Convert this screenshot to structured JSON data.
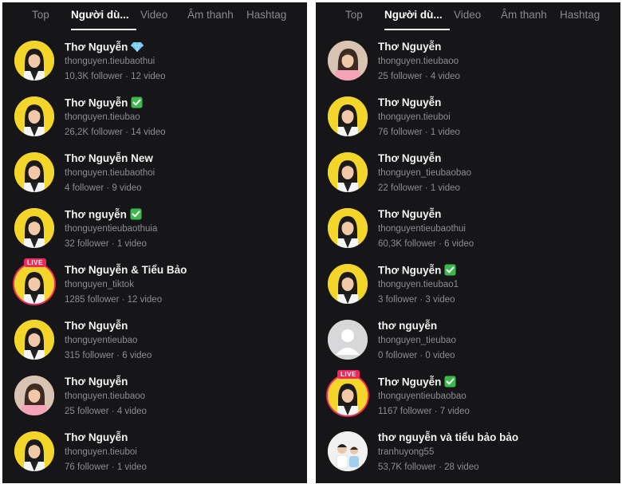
{
  "left_panel": {
    "tabs": [
      "Top",
      "Người dù...",
      "Video",
      "Âm thanh",
      "Hashtag"
    ],
    "active_tab": "Người dù...",
    "users": [
      {
        "name": "Thơ Nguyễn",
        "badge": "diamond-icon",
        "handle": "thonguyen.tieubaothui",
        "stats": "10,3K follower · 12 video",
        "avatar": "yellow-girl",
        "live": false
      },
      {
        "name": "Thơ Nguyễn",
        "badge": "verified-check-icon",
        "handle": "thonguyen.tieubao",
        "stats": "26,2K follower · 14 video",
        "avatar": "yellow-girl",
        "live": false
      },
      {
        "name": "Thơ Nguyễn New",
        "badge": "",
        "handle": "thonguyen.tieubaothoi",
        "stats": "4 follower · 9 video",
        "avatar": "yellow-girl",
        "live": false
      },
      {
        "name": "Thơ nguyễn",
        "badge": "verified-check-icon",
        "handle": "thonguyentieubaothuia",
        "stats": "32 follower · 1 video",
        "avatar": "yellow-girl",
        "live": false
      },
      {
        "name": "Thơ Nguyễn & Tiểu Bảo",
        "badge": "",
        "handle": "thonguyen_tiktok",
        "stats": "1285 follower · 12 video",
        "avatar": "yellow-girl",
        "live": true,
        "live_label": "LIVE"
      },
      {
        "name": "Thơ Nguyễn",
        "badge": "",
        "handle": "thonguyentieubao",
        "stats": "315 follower · 6 video",
        "avatar": "yellow-girl",
        "live": false
      },
      {
        "name": "Thơ Nguyễn",
        "badge": "",
        "handle": "thonguyen.tieubaoo",
        "stats": "25 follower · 4 video",
        "avatar": "pink-girl",
        "live": false
      },
      {
        "name": "Thơ Nguyễn",
        "badge": "",
        "handle": "thonguyen.tieuboi",
        "stats": "76 follower · 1 video",
        "avatar": "yellow-girl",
        "live": false
      }
    ]
  },
  "right_panel": {
    "tabs": [
      "Top",
      "Người dù...",
      "Video",
      "Âm thanh",
      "Hashtag"
    ],
    "active_tab": "Người dù...",
    "users": [
      {
        "name": "Thơ Nguyễn",
        "badge": "",
        "handle": "thonguyen.tieubaoo",
        "stats": "25 follower · 4 video",
        "avatar": "pink-girl",
        "live": false
      },
      {
        "name": "Thơ Nguyễn",
        "badge": "",
        "handle": "thonguyen.tieuboi",
        "stats": "76 follower · 1 video",
        "avatar": "yellow-girl",
        "live": false
      },
      {
        "name": "Thơ Nguyễn",
        "badge": "",
        "handle": "thonguyen_tieubaobao",
        "stats": "22 follower · 1 video",
        "avatar": "yellow-girl",
        "live": false
      },
      {
        "name": "Thơ Nguyễn",
        "badge": "",
        "handle": "thonguyentieubaothui",
        "stats": "60,3K follower · 6 video",
        "avatar": "yellow-girl",
        "live": false
      },
      {
        "name": "Thơ Nguyễn",
        "badge": "verified-check-icon",
        "handle": "thonguyen.tieubao1",
        "stats": "3 follower · 3 video",
        "avatar": "yellow-girl",
        "live": false
      },
      {
        "name": "thơ nguyễn",
        "badge": "",
        "handle": "thonguyen_tieubao",
        "stats": "0 follower · 0 video",
        "avatar": "default-gray",
        "live": false
      },
      {
        "name": "Thơ Nguyễn",
        "badge": "verified-check-icon",
        "handle": "thonguyentieubaobao",
        "stats": "1167 follower · 7 video",
        "avatar": "yellow-girl",
        "live": true,
        "live_label": "LIVE"
      },
      {
        "name": "thơ nguyễn và tiểu bảo bảo",
        "badge": "",
        "handle": "tranhuyong55",
        "stats": "53,7K follower · 28 video",
        "avatar": "white-couple",
        "live": false
      }
    ]
  },
  "colors": {
    "panel_bg": "#161618",
    "text_primary": "#f2f2f2",
    "text_secondary": "#8d8d90",
    "live_red": "#ee2a5c",
    "avatar_yellow": "#f4d52a",
    "diamond_blue": "#67c6f5",
    "check_green": "#3cb94c"
  }
}
